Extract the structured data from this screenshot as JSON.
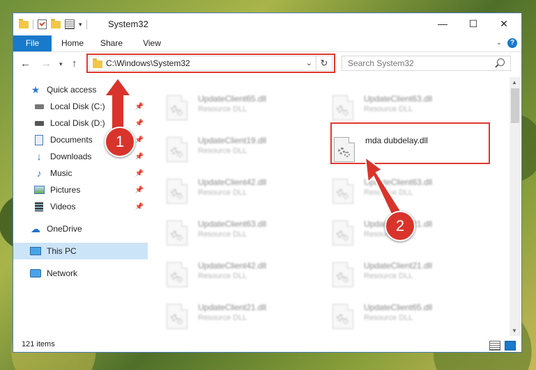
{
  "window": {
    "title": "System32"
  },
  "controls": {
    "minimize": "—",
    "maximize": "☐",
    "close": "✕"
  },
  "ribbon": {
    "tabs": [
      "File",
      "Home",
      "Share",
      "View"
    ]
  },
  "address": {
    "path": "C:\\Windows\\System32"
  },
  "search": {
    "placeholder": "Search System32"
  },
  "sidebar": {
    "items": [
      {
        "label": "Quick access"
      },
      {
        "label": "Local Disk (C:)"
      },
      {
        "label": "Local Disk (D:)"
      },
      {
        "label": "Documents"
      },
      {
        "label": "Downloads"
      },
      {
        "label": "Music"
      },
      {
        "label": "Pictures"
      },
      {
        "label": "Videos"
      },
      {
        "label": "OneDrive"
      },
      {
        "label": "This PC"
      },
      {
        "label": "Network"
      }
    ]
  },
  "files": [
    {
      "name": "UpdateClient65.dll",
      "desc": "Resource DLL"
    },
    {
      "name": "UpdateClient63.dll",
      "desc": "Resource DLL"
    },
    {
      "name": "UpdateClient19.dll",
      "desc": "Resource DLL"
    },
    {
      "name": "mda dubdelay.dll",
      "desc": ""
    },
    {
      "name": "UpdateClient42.dll",
      "desc": "Resource DLL"
    },
    {
      "name": "UpdateClient63.dll",
      "desc": "Resource DLL"
    },
    {
      "name": "UpdateClient63.dll",
      "desc": "Resource DLL"
    },
    {
      "name": "UpdateClient21.dll",
      "desc": "Resource DLL"
    },
    {
      "name": "UpdateClient42.dll",
      "desc": "Resource DLL"
    },
    {
      "name": "UpdateClient21.dll",
      "desc": "Resource DLL"
    },
    {
      "name": "UpdateClient21.dll",
      "desc": "Resource DLL"
    },
    {
      "name": "UpdateClient65.dll",
      "desc": "Resource DLL"
    }
  ],
  "status": {
    "count": "121 items"
  },
  "annotations": {
    "one": "1",
    "two": "2"
  },
  "colors": {
    "accent": "#1979ca",
    "highlight": "#e0382c",
    "selected": "#cce4f7"
  }
}
